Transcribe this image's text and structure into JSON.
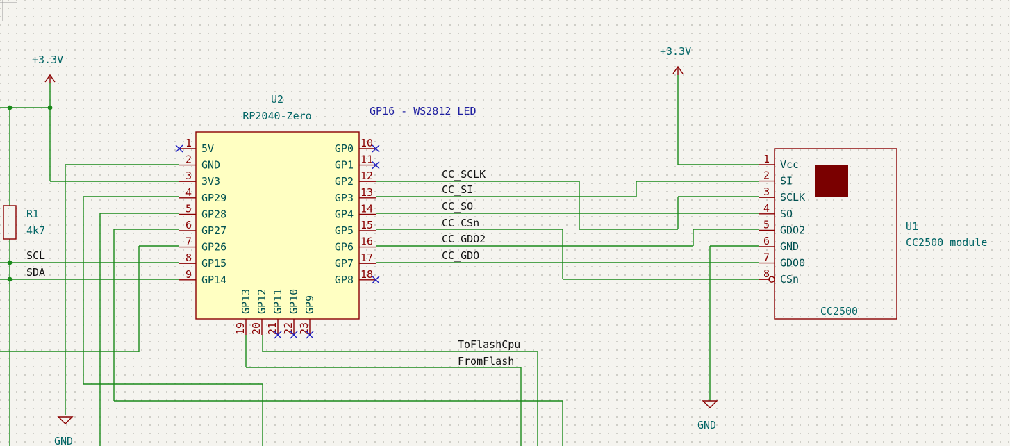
{
  "u2": {
    "ref": "U2",
    "value": "RP2040-Zero",
    "left_pins": [
      {
        "num": "1",
        "name": "5V"
      },
      {
        "num": "2",
        "name": "GND"
      },
      {
        "num": "3",
        "name": "3V3"
      },
      {
        "num": "4",
        "name": "GP29"
      },
      {
        "num": "5",
        "name": "GP28"
      },
      {
        "num": "6",
        "name": "GP27"
      },
      {
        "num": "7",
        "name": "GP26"
      },
      {
        "num": "8",
        "name": "GP15"
      },
      {
        "num": "9",
        "name": "GP14"
      }
    ],
    "right_pins": [
      {
        "num": "10",
        "name": "GP0"
      },
      {
        "num": "11",
        "name": "GP1"
      },
      {
        "num": "12",
        "name": "GP2"
      },
      {
        "num": "13",
        "name": "GP3"
      },
      {
        "num": "14",
        "name": "GP4"
      },
      {
        "num": "15",
        "name": "GP5"
      },
      {
        "num": "16",
        "name": "GP6"
      },
      {
        "num": "17",
        "name": "GP7"
      },
      {
        "num": "18",
        "name": "GP8"
      }
    ],
    "bottom_pins": [
      {
        "num": "19",
        "name": "GP13"
      },
      {
        "num": "20",
        "name": "GP12"
      },
      {
        "num": "21",
        "name": "GP11"
      },
      {
        "num": "22",
        "name": "GP10"
      },
      {
        "num": "23",
        "name": "GP9"
      }
    ]
  },
  "u1": {
    "ref": "U1",
    "value": "CC2500 module",
    "body_label": "CC2500",
    "pins": [
      {
        "num": "1",
        "name": "Vcc"
      },
      {
        "num": "2",
        "name": "SI"
      },
      {
        "num": "3",
        "name": "SCLK"
      },
      {
        "num": "4",
        "name": "SO"
      },
      {
        "num": "5",
        "name": "GDO2"
      },
      {
        "num": "6",
        "name": "GND"
      },
      {
        "num": "7",
        "name": "GDO0"
      },
      {
        "num": "8",
        "name": "CSn"
      }
    ]
  },
  "r1": {
    "ref": "R1",
    "value": "4k7"
  },
  "power": {
    "left_3v3": "+3.3V",
    "right_3v3": "+3.3V",
    "gnd_left": "GND",
    "gnd_right": "GND"
  },
  "net_labels": {
    "cc_sclk": "CC_SCLK",
    "cc_si": "CC_SI",
    "cc_so": "CC_SO",
    "cc_csn": "CC_CSn",
    "cc_gdo2": "CC_GDO2",
    "cc_gdo0": "CC_GDO",
    "scl": "SCL",
    "sda": "SDA",
    "to_flash_cpu": "ToFlashCpu",
    "from_flash": "FromFlash"
  },
  "note": "GP16 - WS2812 LED"
}
